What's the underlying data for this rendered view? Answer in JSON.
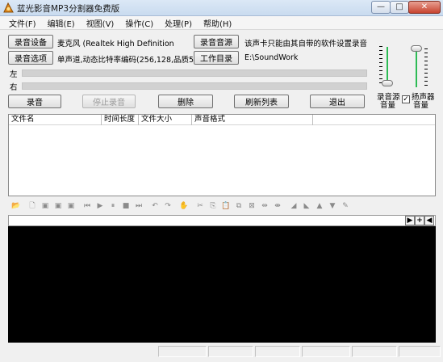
{
  "window": {
    "title": "蓝光影音MP3分割器免费版",
    "minimize_glyph": "—",
    "maximize_glyph": "□",
    "close_glyph": "✕"
  },
  "menu": [
    "文件(F)",
    "编辑(E)",
    "视图(V)",
    "操作(C)",
    "处理(P)",
    "帮助(H)"
  ],
  "recording": {
    "device_button": "录音设备",
    "device_value": "麦克风 (Realtek High Definition",
    "options_button": "录音选项",
    "options_value": "单声道,动态比特率编码(256,128,品质5)",
    "source_button": "录音音源",
    "source_value": "该声卡只能由其自带的软件设置录音",
    "workdir_button": "工作目录",
    "workdir_value": "E:\\SoundWork",
    "left_label": "左",
    "right_label": "右",
    "left_level": 0,
    "right_level": 0
  },
  "actions": {
    "record": "录音",
    "stop": "停止录音",
    "delete": "删除",
    "refresh": "刷新列表",
    "exit": "退出"
  },
  "mixer": {
    "source_volume_label_1": "录音源",
    "source_volume_label_2": "音量",
    "speaker_label_1": "扬声器",
    "speaker_label_2": "音量",
    "speaker_checked": true,
    "check_glyph": "✓"
  },
  "file_list": {
    "columns": [
      "文件名",
      "时间长度",
      "文件大小",
      "声音格式"
    ],
    "rows": []
  },
  "toolbar_icons": [
    {
      "name": "open-folder-icon",
      "glyph": "📂",
      "active": true
    },
    {
      "name": "new-file-icon",
      "glyph": "🗋",
      "active": false
    },
    {
      "name": "save-icon",
      "glyph": "▣",
      "active": false
    },
    {
      "name": "save-as-icon",
      "glyph": "▣",
      "active": false
    },
    {
      "name": "save-selection-icon",
      "glyph": "▣",
      "active": false
    },
    {
      "name": "go-start-icon",
      "glyph": "⏮",
      "active": false
    },
    {
      "name": "play-icon",
      "glyph": "▶",
      "active": false
    },
    {
      "name": "pause-icon",
      "glyph": "⏸",
      "active": false
    },
    {
      "name": "stop-icon",
      "glyph": "■",
      "active": false
    },
    {
      "name": "go-end-icon",
      "glyph": "⏭",
      "active": false
    },
    {
      "name": "undo-icon",
      "glyph": "↶",
      "active": false
    },
    {
      "name": "redo-icon",
      "glyph": "↷",
      "active": false
    },
    {
      "name": "hand-icon",
      "glyph": "✋",
      "active": false
    },
    {
      "name": "cut-icon",
      "glyph": "✂",
      "active": false
    },
    {
      "name": "copy-icon",
      "glyph": "⎘",
      "active": false
    },
    {
      "name": "paste-icon",
      "glyph": "📋",
      "active": false
    },
    {
      "name": "split-icon",
      "glyph": "⧉",
      "active": false
    },
    {
      "name": "mix-icon",
      "glyph": "⊠",
      "active": false
    },
    {
      "name": "zoom-in-time-icon",
      "glyph": "⇹",
      "active": false
    },
    {
      "name": "zoom-out-time-icon",
      "glyph": "⇼",
      "active": false
    },
    {
      "name": "fade-in-icon",
      "glyph": "◢",
      "active": false
    },
    {
      "name": "fade-out-icon",
      "glyph": "◣",
      "active": false
    },
    {
      "name": "volume-up-icon",
      "glyph": "▲",
      "active": false
    },
    {
      "name": "volume-down-icon",
      "glyph": "▼",
      "active": false
    },
    {
      "name": "wand-icon",
      "glyph": "✎",
      "active": false
    }
  ],
  "wave_buttons": {
    "left_zoom": "▶",
    "zoom_in": "+",
    "zoom_out": "◀"
  },
  "colors": {
    "accent_green": "#2dbb55",
    "wave_background": "#000000"
  }
}
